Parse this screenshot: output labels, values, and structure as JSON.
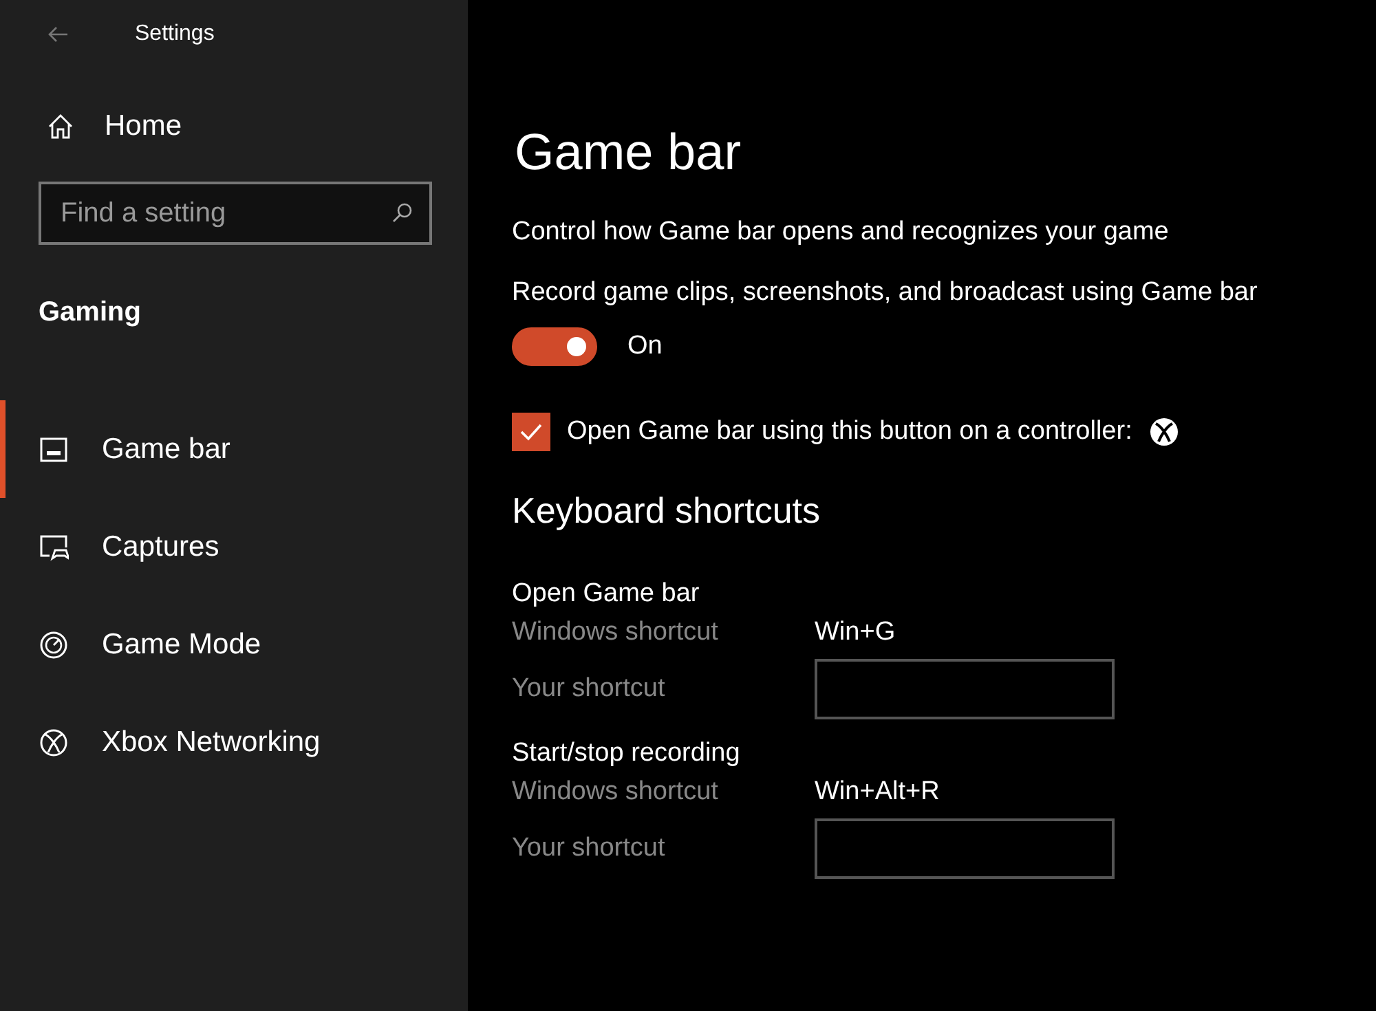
{
  "window": {
    "title": "Settings"
  },
  "sidebar": {
    "home": "Home",
    "search": {
      "placeholder": "Find a setting"
    },
    "section": "Gaming",
    "items": [
      {
        "label": "Game bar",
        "selected": true
      },
      {
        "label": "Captures",
        "selected": false
      },
      {
        "label": "Game Mode",
        "selected": false
      },
      {
        "label": "Xbox Networking",
        "selected": false
      }
    ]
  },
  "page": {
    "title": "Game bar",
    "description": "Control how Game bar opens and recognizes your game",
    "record_toggle": {
      "label": "Record game clips, screenshots, and broadcast using Game bar",
      "on": true,
      "state_text": "On"
    },
    "controller_checkbox": {
      "label": "Open Game bar using this button on a controller:",
      "checked": true
    },
    "shortcuts_heading": "Keyboard shortcuts",
    "shortcuts": [
      {
        "title": "Open Game bar",
        "windows_label": "Windows shortcut",
        "windows_shortcut": "Win+G",
        "your_label": "Your shortcut"
      },
      {
        "title": "Start/stop recording",
        "windows_label": "Windows shortcut",
        "windows_shortcut": "Win+Alt+R",
        "your_label": "Your shortcut"
      }
    ]
  }
}
